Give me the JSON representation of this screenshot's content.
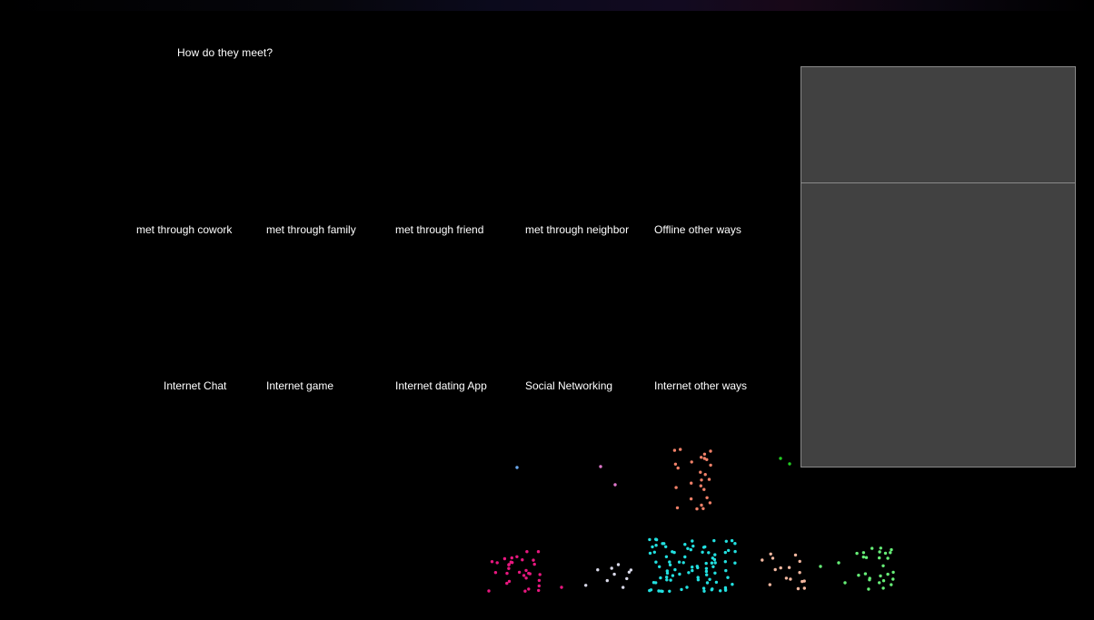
{
  "title": "How do they meet?",
  "offline_categories": [
    "met through cowork",
    "met through family",
    "met through friend",
    "met through neighbor",
    "Offline other ways"
  ],
  "online_categories": [
    "Internet Chat",
    "Internet game",
    "Internet dating App",
    "Social Networking",
    "Internet other ways"
  ],
  "colors": {
    "background": "#000000",
    "panel": "#414141",
    "panel_border": "#8a8a8a",
    "text": "#ffffff",
    "dot_groups": [
      "#e8177f",
      "#d8d8e8",
      "#22e0e0",
      "#f4b8a0",
      "#66ee77",
      "#f08068",
      "#6aa8ee",
      "#e078cc",
      "#22cc22"
    ]
  }
}
